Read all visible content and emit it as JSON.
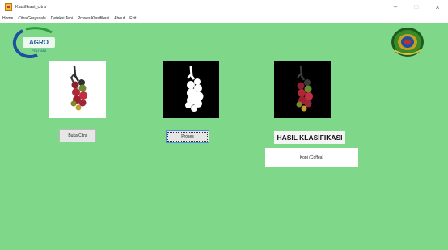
{
  "window": {
    "title": "Klasifikasi_citra",
    "minimize": "–",
    "maximize": "□",
    "close": "×"
  },
  "menu": [
    "Home",
    "Citra Grayscale",
    "Deteksi Tepi",
    "Proses Klasifikasi",
    "About",
    "Exit"
  ],
  "buttons": {
    "open_image": "Buka Citra",
    "process": "Proses"
  },
  "result": {
    "heading": "HASIL KLASIFIKASI",
    "value": "Kopi (Coffea)"
  },
  "logo": {
    "text": "AGRO",
    "subtext": "POLITANI"
  },
  "colors": {
    "panel_background": "#7fd889",
    "logo_blue": "#1e4fa0",
    "logo_green": "#2a9a3a"
  }
}
